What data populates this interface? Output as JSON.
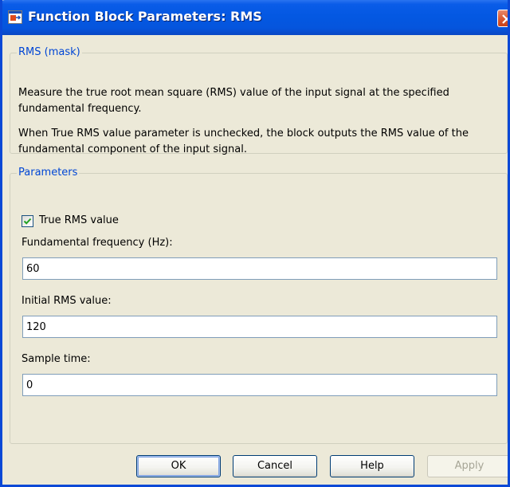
{
  "window": {
    "title": "Function Block Parameters: RMS"
  },
  "mask_group": {
    "legend": "RMS (mask)",
    "description_1": "Measure the true root mean square (RMS) value of the input signal at the specified fundamental frequency.",
    "description_2": "When True RMS value parameter is unchecked, the block outputs the RMS value of the fundamental component of the input signal."
  },
  "parameters_group": {
    "legend": "Parameters",
    "true_rms": {
      "label": "True RMS value",
      "checked": true
    },
    "fundamental_frequency": {
      "label": "Fundamental frequency (Hz):",
      "value": "60"
    },
    "initial_rms": {
      "label": "Initial RMS value:",
      "value": "120"
    },
    "sample_time": {
      "label": "Sample time:",
      "value": "0"
    }
  },
  "buttons": {
    "ok": "OK",
    "cancel": "Cancel",
    "help": "Help",
    "apply": "Apply"
  },
  "colors": {
    "titlebar": "#0458e2",
    "dialog_bg": "#ece9d8",
    "legend_text": "#0046d5",
    "close_button": "#d95b34"
  }
}
